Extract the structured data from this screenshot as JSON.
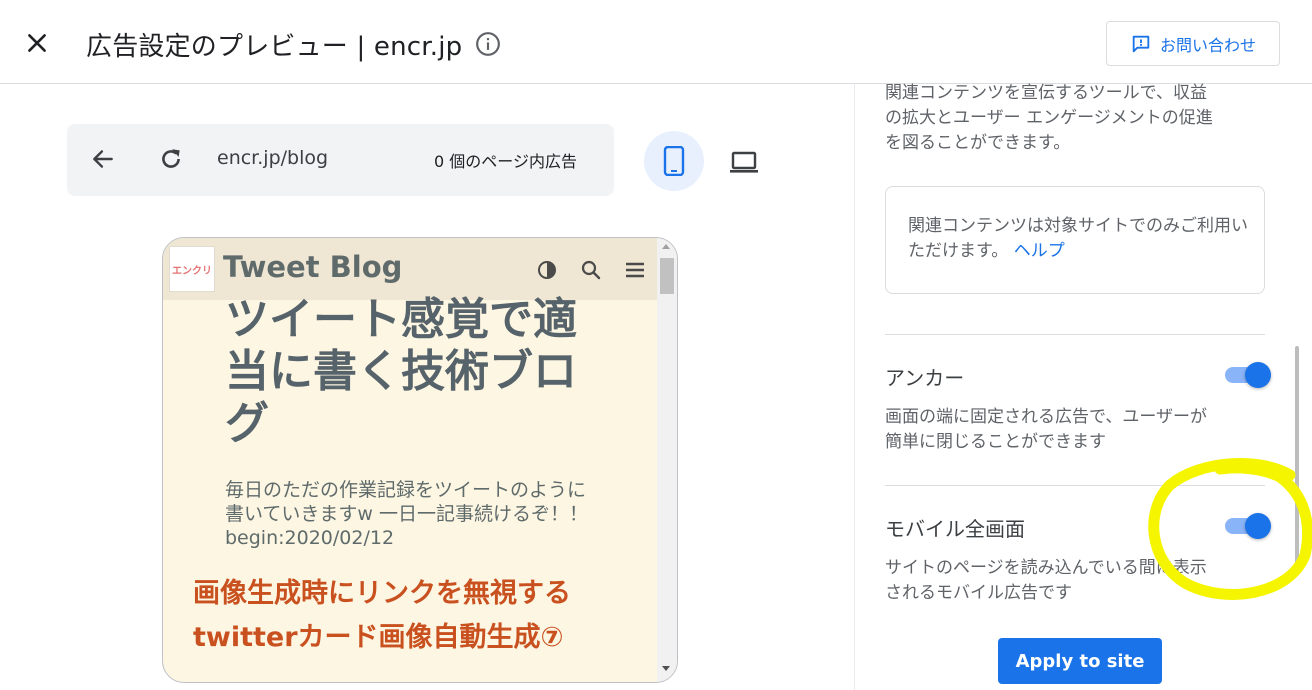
{
  "header": {
    "title": "広告設定のプレビュー | encr.jp",
    "contact_label": "お問い合わせ"
  },
  "preview": {
    "url": "encr.jp/blog",
    "ad_count": "0 個のページ内広告"
  },
  "site": {
    "logo_text": "エンクリ",
    "blog_name": "Tweet Blog",
    "blog_title": "ツイート感覚で適当に書く技術ブログ",
    "blog_description": "毎日のただの作業記録をツイートのように書いていきますw 一日一記事続けるぞ！！begin:2020/02/12",
    "post_title": "画像生成時にリンクを無視する　twitterカード画像自動生成⑦"
  },
  "settings": {
    "related_desc": "関連コンテンツを宣伝するツールで、収益の拡大とユーザー エンゲージメントの促進を図ることができます。",
    "related_notice": "関連コンテンツは対象サイトでのみご利用いただけます。",
    "help_link": "ヘルプ",
    "anchor_label": "アンカー",
    "anchor_desc": "画面の端に固定される広告で、ユーザーが簡単に閉じることができます",
    "anchor_enabled": true,
    "vignette_label": "モバイル全画面",
    "vignette_desc": "サイトのページを読み込んでいる間に表示されるモバイル広告です",
    "vignette_enabled": true,
    "apply_label": "Apply to site"
  },
  "colors": {
    "accent": "#1a73e8",
    "highlight": "#f5f500",
    "post_title": "#c9511f"
  }
}
